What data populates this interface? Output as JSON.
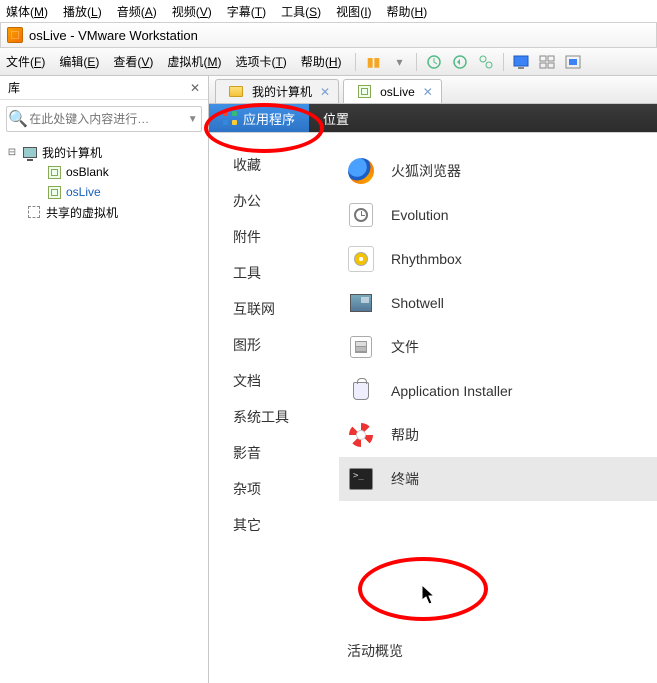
{
  "host_menu": [
    {
      "label": "媒体",
      "mn": "M"
    },
    {
      "label": "播放",
      "mn": "L"
    },
    {
      "label": "音频",
      "mn": "A"
    },
    {
      "label": "视频",
      "mn": "V"
    },
    {
      "label": "字幕",
      "mn": "T"
    },
    {
      "label": "工具",
      "mn": "S"
    },
    {
      "label": "视图",
      "mn": "I"
    },
    {
      "label": "帮助",
      "mn": "H"
    }
  ],
  "window_title": "osLive - VMware Workstation",
  "app_menu": [
    {
      "label": "文件",
      "mn": "F"
    },
    {
      "label": "编辑",
      "mn": "E"
    },
    {
      "label": "查看",
      "mn": "V"
    },
    {
      "label": "虚拟机",
      "mn": "M"
    },
    {
      "label": "选项卡",
      "mn": "T"
    },
    {
      "label": "帮助",
      "mn": "H"
    }
  ],
  "sidebar": {
    "title": "库",
    "search_placeholder": "在此处键入内容进行…",
    "root": "我的计算机",
    "node_osblank": "osBlank",
    "node_oslive": "osLive",
    "shared": "共享的虚拟机"
  },
  "tabs": [
    {
      "label": "我的计算机",
      "id": "tab-mycomputer"
    },
    {
      "label": "osLive",
      "id": "tab-oslive"
    }
  ],
  "panel": {
    "applications": "应用程序",
    "places": "位置"
  },
  "categories": [
    "收藏",
    "办公",
    "附件",
    "工具",
    "互联网",
    "图形",
    "文档",
    "系统工具",
    "影音",
    "杂项",
    "其它"
  ],
  "apps": [
    {
      "label": "火狐浏览器",
      "icon": "firefox"
    },
    {
      "label": "Evolution",
      "icon": "evolution"
    },
    {
      "label": "Rhythmbox",
      "icon": "rhythmbox"
    },
    {
      "label": "Shotwell",
      "icon": "shotwell"
    },
    {
      "label": "文件",
      "icon": "files"
    },
    {
      "label": "Application Installer",
      "icon": "installer"
    },
    {
      "label": "帮助",
      "icon": "help"
    },
    {
      "label": "终端",
      "icon": "terminal"
    }
  ],
  "activities_overview": "活动概览"
}
